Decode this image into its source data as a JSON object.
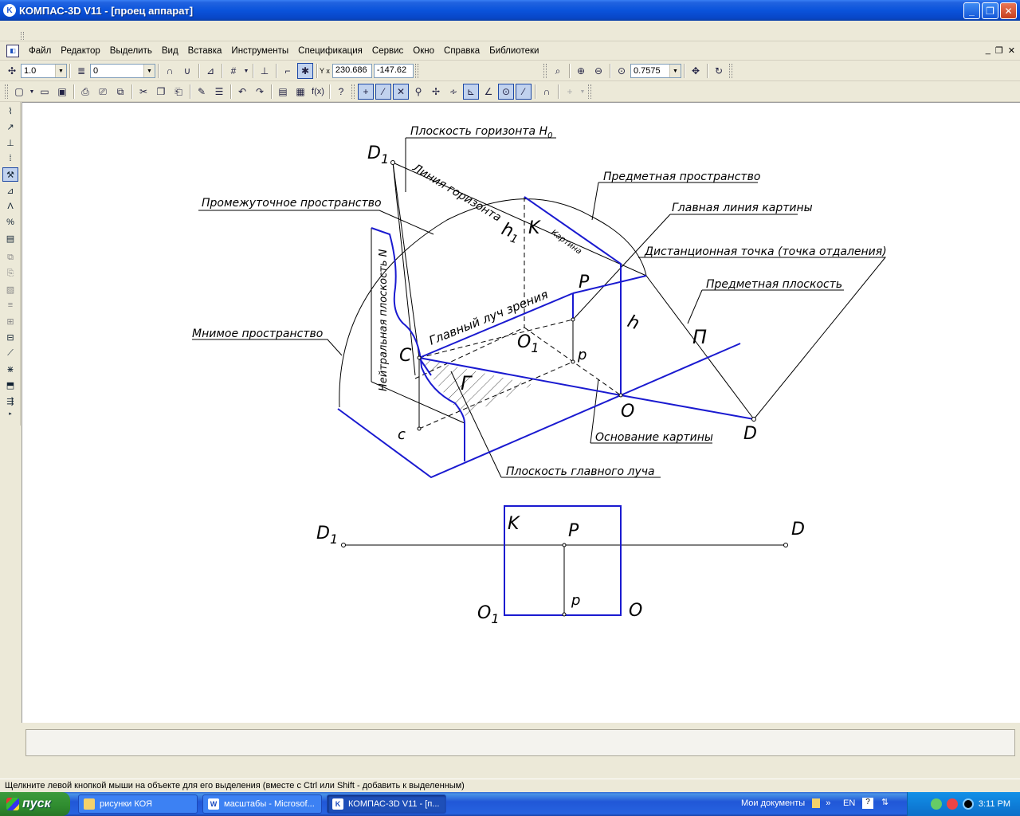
{
  "window": {
    "title": "КОМПАС-3D V11 - [проец аппарат]",
    "app_icon": "kompas-icon"
  },
  "menu": {
    "items": [
      "Файл",
      "Редактор",
      "Выделить",
      "Вид",
      "Вставка",
      "Инструменты",
      "Спецификация",
      "Сервис",
      "Окно",
      "Справка",
      "Библиотеки"
    ]
  },
  "toolbar": {
    "step_value": "1.0",
    "layer_value": "0",
    "coord_label": "Y x",
    "coord_x": "230.686",
    "coord_y": "-147.62",
    "zoom_value": "0.7575"
  },
  "drawing": {
    "labels": {
      "horizon_plane": "Плоскость горизонта H",
      "horizon_plane_sub": "0",
      "d1_top": "D",
      "d1_top_sub": "1",
      "horizon_line": "Линия горизонта",
      "object_space": "Предметная пространство",
      "intermediate_space": "Промежуточное пространство",
      "h1": "h",
      "h1_sub": "1",
      "k_top": "K",
      "picture_word": "Картина",
      "main_line": "Главная линия картины",
      "distance_point": "Дистанционная точка (точка отдаления)",
      "neutral_plane": "Нейтральная плоскость N",
      "p_upper": "P",
      "object_plane": "Предметная плоскость",
      "main_ray": "Главный луч зрения",
      "h_lower": "h",
      "pi": "П",
      "imaginary_space": "Мнимое пространство",
      "c_upper": "C",
      "o1_mid": "O",
      "o1_mid_sub": "1",
      "p_lower": "p",
      "gamma": "Г",
      "o_mid": "O",
      "d_mid": "D",
      "c_lower": "c",
      "base_picture": "Основание картины",
      "main_ray_plane": "Плоскость главного луча",
      "d1_bottom": "D",
      "d1_bottom_sub": "1",
      "d_bottom": "D",
      "k_bottom": "K",
      "p_bottom_upper": "P",
      "p_bottom_lower": "p",
      "o1_bottom": "O",
      "o1_bottom_sub": "1",
      "o_bottom": "O"
    },
    "colors": {
      "blue": "#1a1ad0",
      "line": "#000000"
    }
  },
  "status": {
    "hint": "Щелкните левой кнопкой мыши на объекте для его выделения (вместе с Ctrl или Shift - добавить к выделенным)"
  },
  "taskbar": {
    "start": "пуск",
    "tasks": [
      "рисунки КОЯ",
      "масштабы - Microsof...",
      "КОМПАС-3D V11 - [п..."
    ],
    "my_docs": "Мои документы",
    "lang": "EN",
    "clock": "3:11 PM"
  }
}
